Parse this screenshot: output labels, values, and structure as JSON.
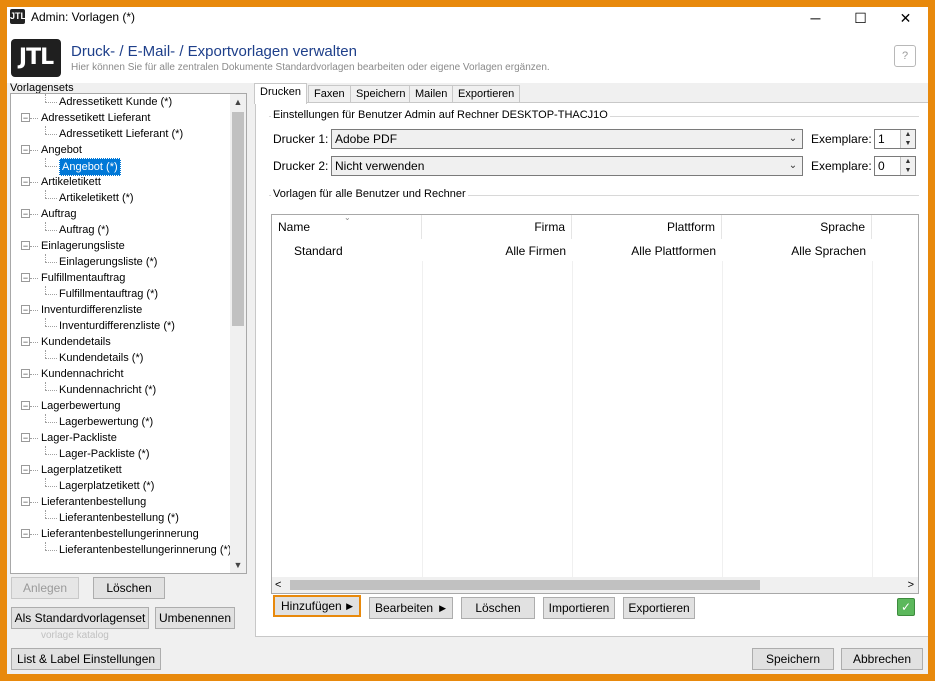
{
  "window": {
    "title": "Admin: Vorlagen (*)",
    "app_icon": "JTL",
    "minimize_glyph": "─",
    "maximize_glyph": "☐",
    "close_glyph": "✕"
  },
  "header": {
    "logo": "JTL",
    "title": "Druck- / E-Mail- / Exportvorlagen verwalten",
    "subtitle": "Hier können Sie für alle zentralen Dokumente Standardvorlagen bearbeiten oder eigene Vorlagen ergänzen.",
    "help_glyph": "?"
  },
  "sidebar": {
    "label": "Vorlagensets",
    "tree": [
      {
        "label": "Adressetikett Kunde (*)",
        "level": 1
      },
      {
        "label": "Adressetikett Lieferant",
        "level": 0
      },
      {
        "label": "Adressetikett Lieferant (*)",
        "level": 1
      },
      {
        "label": "Angebot",
        "level": 0
      },
      {
        "label": "Angebot (*)",
        "level": 1,
        "selected": true
      },
      {
        "label": "Artikeletikett",
        "level": 0
      },
      {
        "label": "Artikeletikett (*)",
        "level": 1
      },
      {
        "label": "Auftrag",
        "level": 0
      },
      {
        "label": "Auftrag (*)",
        "level": 1
      },
      {
        "label": "Einlagerungsliste",
        "level": 0
      },
      {
        "label": "Einlagerungsliste (*)",
        "level": 1
      },
      {
        "label": "Fulfillmentauftrag",
        "level": 0
      },
      {
        "label": "Fulfillmentauftrag (*)",
        "level": 1
      },
      {
        "label": "Inventurdifferenzliste",
        "level": 0
      },
      {
        "label": "Inventurdifferenzliste (*)",
        "level": 1
      },
      {
        "label": "Kundendetails",
        "level": 0
      },
      {
        "label": "Kundendetails (*)",
        "level": 1
      },
      {
        "label": "Kundennachricht",
        "level": 0
      },
      {
        "label": "Kundennachricht (*)",
        "level": 1
      },
      {
        "label": "Lagerbewertung",
        "level": 0
      },
      {
        "label": "Lagerbewertung (*)",
        "level": 1
      },
      {
        "label": "Lager-Packliste",
        "level": 0
      },
      {
        "label": "Lager-Packliste (*)",
        "level": 1
      },
      {
        "label": "Lagerplatzetikett",
        "level": 0
      },
      {
        "label": "Lagerplatzetikett (*)",
        "level": 1
      },
      {
        "label": "Lieferantenbestellung",
        "level": 0
      },
      {
        "label": "Lieferantenbestellung (*)",
        "level": 1
      },
      {
        "label": "Lieferantenbestellungerinnerung",
        "level": 0
      },
      {
        "label": "Lieferantenbestellungerinnerung (*)",
        "level": 1
      }
    ],
    "buttons": {
      "anlegen": "Anlegen",
      "loeschen": "Löschen",
      "standard": "Als Standardvorlagenset",
      "umbenennen": "Umbenennen"
    },
    "ghost_text": "vorlage katalog"
  },
  "tabs": [
    "Drucken",
    "Faxen",
    "Speichern",
    "Mailen",
    "Exportieren"
  ],
  "printer_settings": {
    "group_label": "Einstellungen für Benutzer Admin auf Rechner DESKTOP-THACJ1O",
    "rows": [
      {
        "label": "Drucker 1:",
        "value": "Adobe PDF",
        "copies_label": "Exemplare:",
        "copies": "1"
      },
      {
        "label": "Drucker 2:",
        "value": "Nicht verwenden",
        "copies_label": "Exemplare:",
        "copies": "0"
      }
    ]
  },
  "templates": {
    "group_label": "Vorlagen für alle Benutzer und Rechner",
    "columns": [
      "Name",
      "Firma",
      "Plattform",
      "Sprache"
    ],
    "rows": [
      [
        "Standard",
        "Alle Firmen",
        "Alle Plattformen",
        "Alle Sprachen"
      ]
    ]
  },
  "actions": {
    "hinzufuegen": "Hinzufügen",
    "bearbeiten": "Bearbeiten",
    "loeschen": "Löschen",
    "importieren": "Importieren",
    "exportieren": "Exportieren"
  },
  "footer": {
    "list_label": "List & Label Einstellungen",
    "speichern": "Speichern",
    "abbrechen": "Abbrechen"
  },
  "colors": {
    "accent_highlight": "#e8890c",
    "selection": "#0078d7",
    "header_title": "#1e3f8a"
  }
}
